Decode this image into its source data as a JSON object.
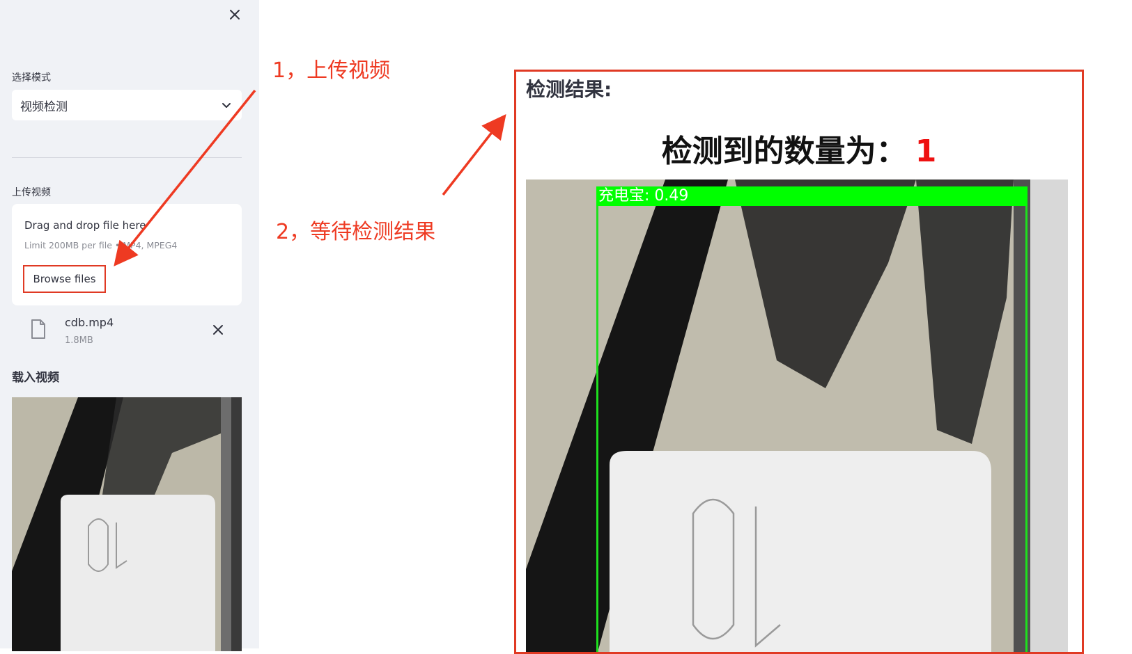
{
  "sidebar": {
    "mode_label": "选择模式",
    "mode_value": "视频检测",
    "upload_label": "上传视频",
    "dropzone": {
      "title": "Drag and drop file here",
      "limit": "Limit 200MB per file • MP4, MPEG4",
      "browse_label": "Browse files"
    },
    "file": {
      "name": "cdb.mp4",
      "size": "1.8MB"
    },
    "loaded_video_title": "载入视频"
  },
  "annotations": {
    "step1": "1，上传视频",
    "step2": "2，等待检测结果",
    "color": "#ee3a22"
  },
  "result": {
    "heading": "检测结果:",
    "count_label": "检测到的数量为：",
    "count_value": "1",
    "detection_label": "充电宝: 0.49",
    "box_color": "#00ff00"
  },
  "icons": {
    "close": "close-icon",
    "chevron": "chevron-down-icon",
    "file": "file-icon",
    "remove": "close-icon"
  }
}
